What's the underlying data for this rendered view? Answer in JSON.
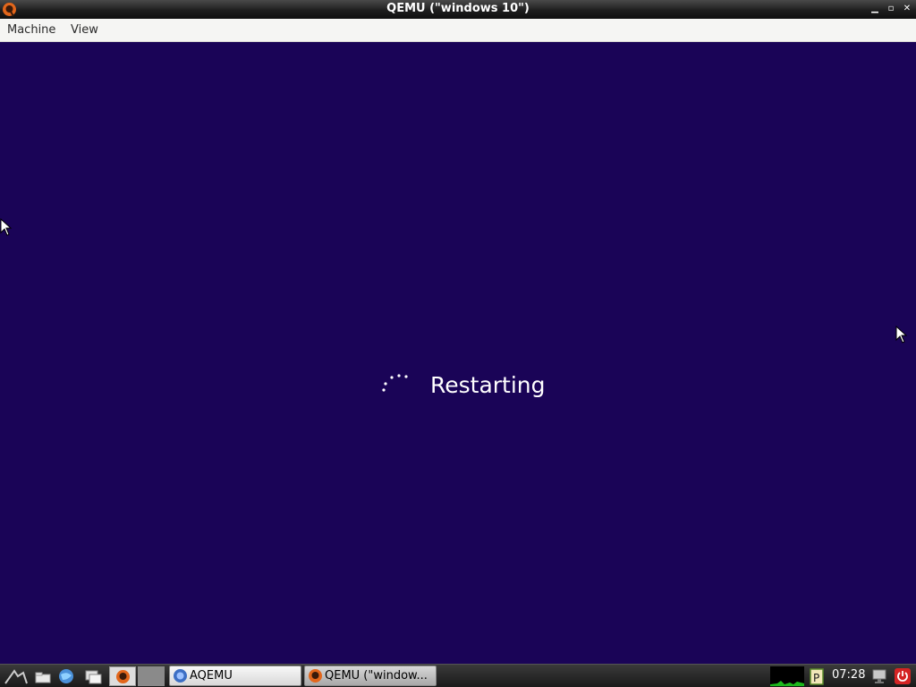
{
  "window": {
    "title": "QEMU (\"windows 10\")",
    "app_icon": "qemu-logo-icon",
    "controls": [
      "minimize-icon",
      "restore-icon",
      "close-icon"
    ]
  },
  "menubar": {
    "items": [
      {
        "label": "Machine"
      },
      {
        "label": "View"
      }
    ]
  },
  "vm": {
    "background": "#1a0457",
    "status_text": "Restarting",
    "spinner": "loading-dots-icon"
  },
  "taskbar": {
    "launchers": [
      "start-menu-icon",
      "file-manager-icon",
      "browser-icon",
      "show-desktop-icon",
      "qemu-launcher-icon"
    ],
    "tasks": [
      {
        "label": "AQEMU",
        "icon": "aqemu-icon",
        "state": "active"
      },
      {
        "label": "QEMU (\"window...",
        "icon": "qemu-logo-icon",
        "state": "inactive"
      }
    ],
    "tray": [
      "cpu-monitor",
      "clipboard-icon",
      "network-icon",
      "power-icon"
    ],
    "clock": "07:28"
  }
}
